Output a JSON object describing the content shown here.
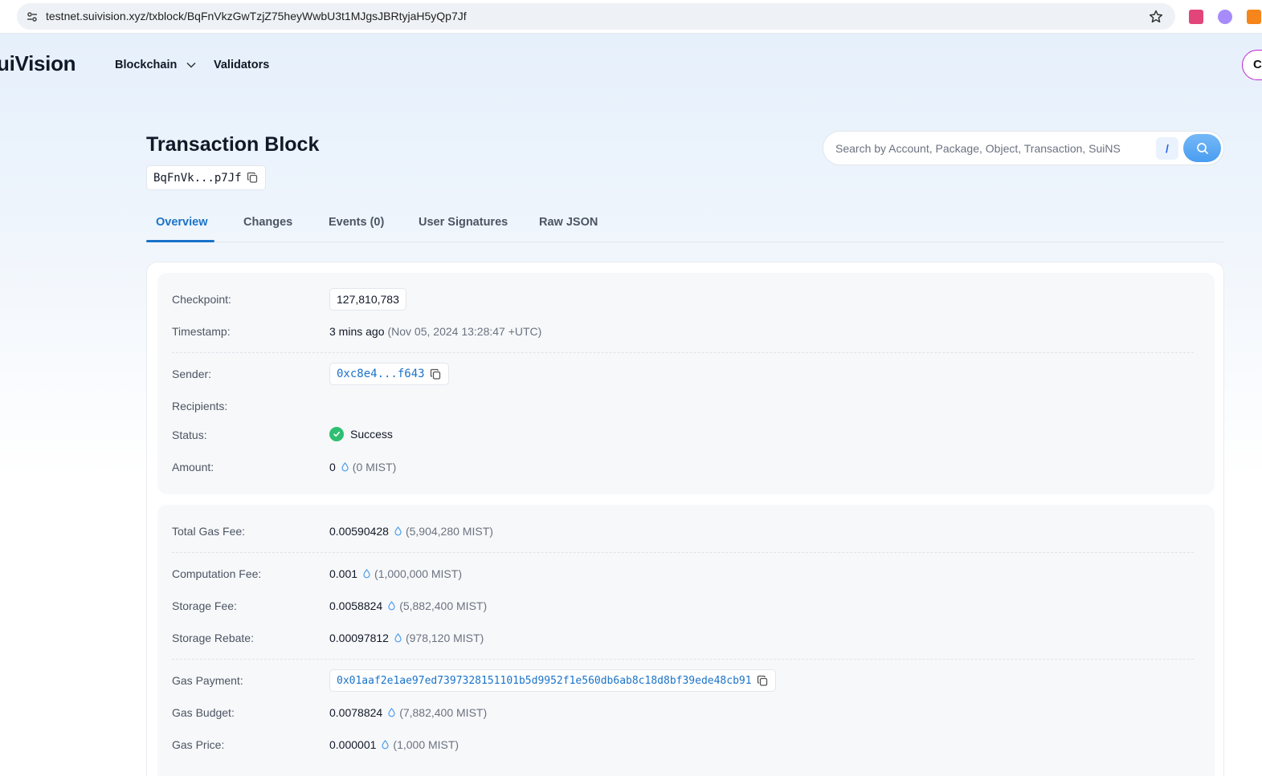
{
  "browser": {
    "url": "testnet.suivision.xyz/txblock/BqFnVkzGwTzjZ75heyWwbU3t1MJgsJBRtyjaH5yQp7Jf"
  },
  "header": {
    "brand": "uiVision",
    "nav": {
      "blockchain": "Blockchain",
      "validators": "Validators"
    },
    "connect_label": "C"
  },
  "page": {
    "title": "Transaction Block",
    "hash_short": "BqFnVk...p7Jf"
  },
  "search": {
    "placeholder": "Search by Account, Package, Object, Transaction, SuiNS",
    "shortcut": "/"
  },
  "tabs": [
    {
      "label": "Overview",
      "active": true
    },
    {
      "label": "Changes",
      "active": false
    },
    {
      "label": "Events (0)",
      "active": false
    },
    {
      "label": "User Signatures",
      "active": false
    },
    {
      "label": "Raw JSON",
      "active": false
    }
  ],
  "overview": {
    "checkpoint": {
      "label": "Checkpoint:",
      "value": "127,810,783"
    },
    "timestamp": {
      "label": "Timestamp:",
      "relative": "3 mins ago",
      "absolute": "(Nov 05, 2024 13:28:47 +UTC)"
    },
    "sender": {
      "label": "Sender:",
      "value": "0xc8e4...f643"
    },
    "recipients": {
      "label": "Recipients:"
    },
    "status": {
      "label": "Status:",
      "value": "Success"
    },
    "amount": {
      "label": "Amount:",
      "value": "0",
      "mist": "(0 MIST)"
    }
  },
  "gas": {
    "total": {
      "label": "Total Gas Fee:",
      "value": "0.00590428",
      "mist": "(5,904,280 MIST)"
    },
    "computation": {
      "label": "Computation Fee:",
      "value": "0.001",
      "mist": "(1,000,000 MIST)"
    },
    "storage": {
      "label": "Storage Fee:",
      "value": "0.0058824",
      "mist": "(5,882,400 MIST)"
    },
    "rebate": {
      "label": "Storage Rebate:",
      "value": "0.00097812",
      "mist": "(978,120 MIST)"
    },
    "payment": {
      "label": "Gas Payment:",
      "value": "0x01aaf2e1ae97ed7397328151101b5d9952f1e560db6ab8c18d8bf39ede48cb91"
    },
    "budget": {
      "label": "Gas Budget:",
      "value": "0.0078824",
      "mist": "(7,882,400 MIST)"
    },
    "price": {
      "label": "Gas Price:",
      "value": "0.000001",
      "mist": "(1,000 MIST)"
    }
  },
  "colors": {
    "accent": "#1a73c9",
    "success": "#2fbf71",
    "connect_border": "#c026d3"
  }
}
